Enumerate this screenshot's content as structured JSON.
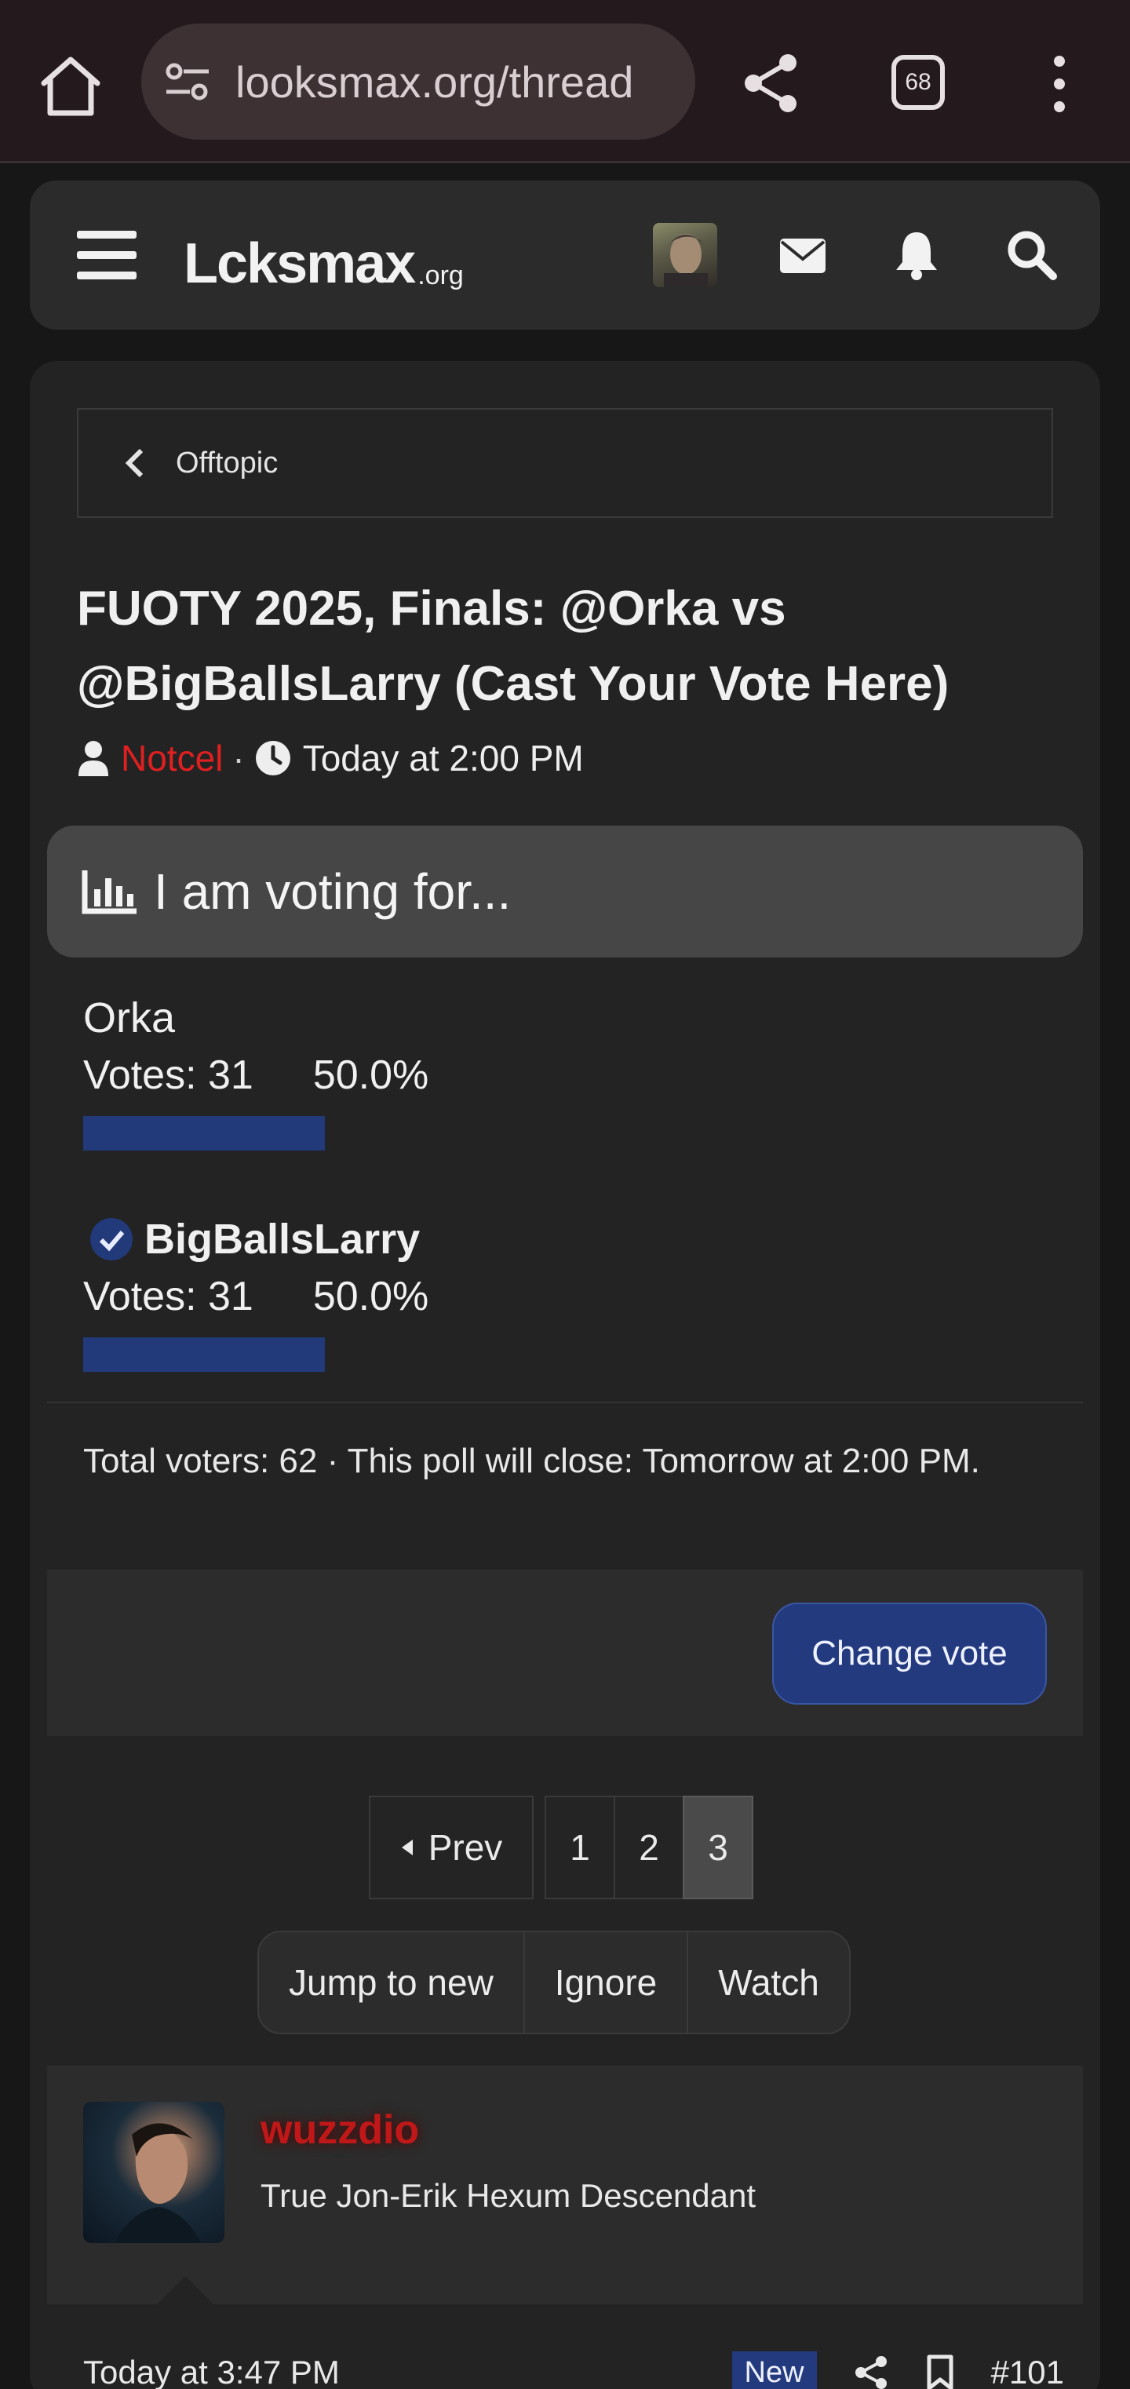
{
  "browser": {
    "url": "looksmax.org/thread",
    "tab_count": "68",
    "icons": [
      "home-icon",
      "site-settings-icon",
      "share-icon",
      "tabs-icon",
      "more-vert-icon"
    ]
  },
  "header": {
    "logo_main": "Lcksmax",
    "logo_suffix": ".org",
    "icons": [
      "hamburger-icon",
      "avatar",
      "mail-icon",
      "bell-icon",
      "search-icon"
    ]
  },
  "breadcrumb": {
    "label": "Offtopic"
  },
  "thread": {
    "title": "FUOTY 2025, Finals: @Orka vs @BigBallsLarry (Cast Your Vote Here)",
    "author": "Notcel",
    "separator": "·",
    "time": "Today at 2:00 PM"
  },
  "poll": {
    "question": "I am voting for...",
    "options": [
      {
        "name": "Orka",
        "votes_text": "Votes: 31",
        "percent_text": "50.0%",
        "fraction": 0.5,
        "voted": false
      },
      {
        "name": "BigBallsLarry",
        "votes_text": "Votes: 31",
        "percent_text": "50.0%",
        "fraction": 0.5,
        "voted": true
      }
    ],
    "footer": "Total voters: 62 · This poll will close: Tomorrow at 2:00 PM.",
    "change_vote_label": "Change vote",
    "bar_color": "#223a7a"
  },
  "pagination": {
    "prev_label": "Prev",
    "pages": [
      "1",
      "2",
      "3"
    ],
    "current": "3"
  },
  "thread_actions": {
    "jump_label": "Jump to new",
    "ignore_label": "Ignore",
    "watch_label": "Watch"
  },
  "post": {
    "username": "wuzzdio",
    "user_title": "True Jon-Erik Hexum Descendant",
    "time": "Today at 3:47 PM",
    "new_badge": "New",
    "post_number": "#101"
  },
  "colors": {
    "accent_blue": "#233a7e",
    "author_red": "#e02020",
    "username_red": "#c01818"
  }
}
